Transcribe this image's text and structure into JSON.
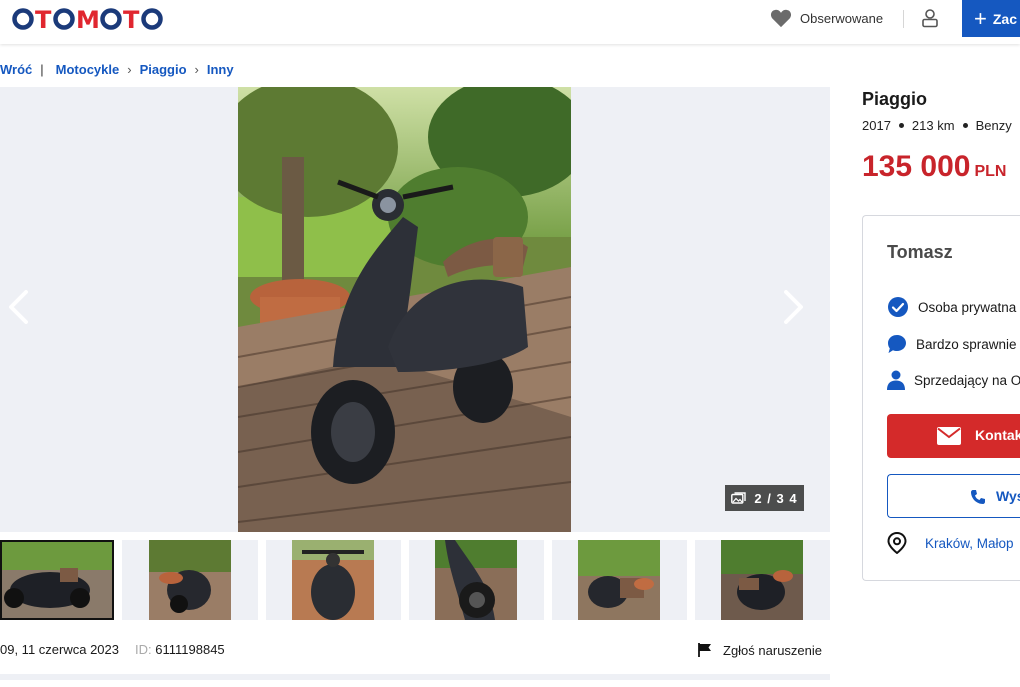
{
  "header": {
    "logo_text": "OTOMOTO",
    "watchlist_label": "Obserwowane",
    "add_button_label": "Zac",
    "colors": {
      "logo_red": "#e0262f",
      "logo_blue": "#1b3a7a",
      "primary_blue": "#1558c0"
    }
  },
  "breadcrumb": {
    "back": "Wróć",
    "items": [
      "Motocykle",
      "Piaggio",
      "Inny"
    ]
  },
  "gallery": {
    "counter": "2 / 3 4",
    "thumbnail_count": 6,
    "active_thumbnail": 1
  },
  "listing": {
    "date": "09, 11 czerwca 2023",
    "id_label": "ID:",
    "id_value": "6111198845",
    "report_label": "Zgłoś naruszenie",
    "title": "Piaggio",
    "specs": [
      "2017",
      "213 km",
      "Benzy"
    ],
    "price": "135 000",
    "currency": "PLN",
    "price_color": "#c8242b"
  },
  "seller": {
    "name": "Tomasz",
    "rows": [
      {
        "icon": "verified-check-icon",
        "text": "Osoba prywatna"
      },
      {
        "icon": "chat-bubble-icon",
        "text": "Bardzo sprawnie"
      },
      {
        "icon": "person-icon",
        "text": "Sprzedający na O"
      }
    ],
    "contact_button": "Kontak",
    "send_button": "Wys",
    "location": "Kraków, Małop"
  }
}
